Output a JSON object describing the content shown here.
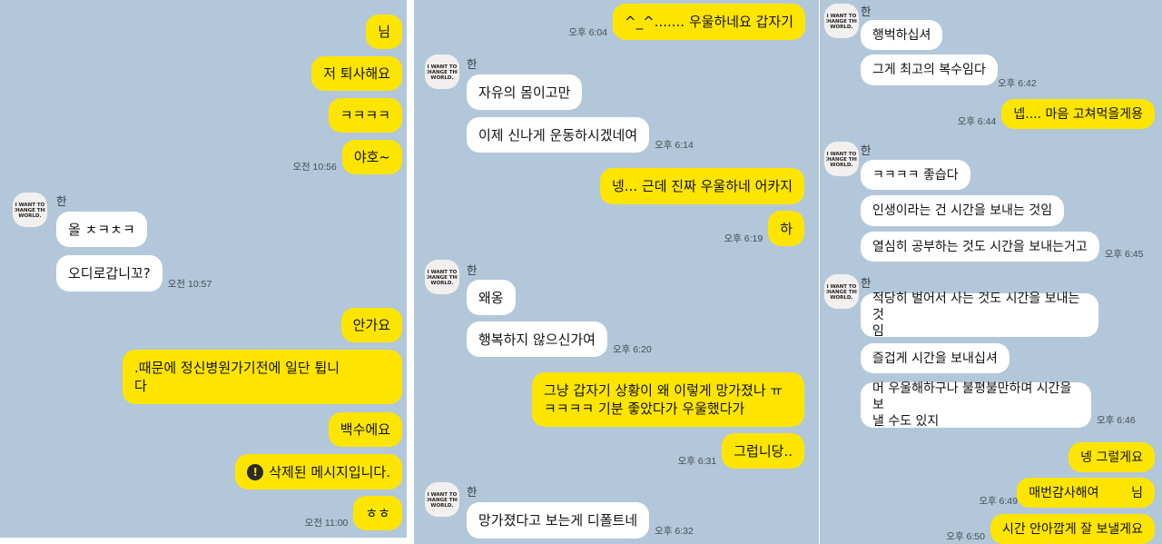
{
  "panel1": {
    "msg1": "님",
    "msg2": "저 퇴사해요",
    "msg3": "ㅋㅋㅋㅋ",
    "msg4": "야호~",
    "time1": "오전 10:56",
    "sender1": "한",
    "msg5": "올 ㅊㅋㅊㅋ",
    "msg6": "오디로갑니꼬?",
    "time2": "오전 10:57",
    "msg7": "안가요",
    "msg8": ".때문에 정신병원가기전에 일단 튑니\n다",
    "msg9": "백수에요",
    "msg10": "삭제된 메시지입니다.",
    "msg11": "ㅎㅎ",
    "time3": "오전 11:00"
  },
  "panel2": {
    "msg1": "^_^....... 우울하네요 갑자기",
    "time1": "오후 6:04",
    "sender1": "한",
    "msg2": "자유의 몸이고만",
    "msg3": "이제 신나게 운동하시겠네여",
    "time2": "오후 6:14",
    "msg4": "넹... 근데 진짜 우울하네 어카지",
    "msg5": "하",
    "time3": "오후 6:19",
    "sender2": "한",
    "msg6": "왜옹",
    "msg7": "행복하지 않으신가여",
    "time4": "오후 6:20",
    "msg8": "그냥 갑자기 상황이 왜 이렇게 망가졌나 ㅠ\nㅋㅋㅋㅋ 기분 좋았다가 우울했다가",
    "msg9": "그럽니당..",
    "time5": "오후 6:31",
    "sender3": "한",
    "msg10": "망가졌다고 보는게 디폴트네",
    "time6": "오후 6:32"
  },
  "panel3": {
    "sender1": "한",
    "msg1": "행벅하십셔",
    "msg2": "그게 최고의 복수임다",
    "time1": "오후 6:42",
    "msg3": "넵.... 마음 고쳐먹을게용",
    "time2": "오후 6:44",
    "sender2": "한",
    "msg4": "ㅋㅋㅋㅋ 좋습다",
    "msg5": "인생이라는 건 시간을 보내는 것임",
    "msg6": "열심히 공부하는 것도 시간을 보내는거고",
    "time3": "오후 6:45",
    "sender3": "한",
    "msg7": "적당히 벌어서 사는 것도 시간을 보내는 것\n임",
    "msg8": "즐겁게 시간을 보내십셔",
    "msg9": "머 우울해하구나 불평불만하며 시간을 보\n낼 수도 있지",
    "time4": "오후 6:46",
    "msg10": "넹 그럴게요",
    "msg11": "매번감사해여        님",
    "time5": "오후 6:49",
    "msg12": "시간 안아깝게 잘 보낼게요",
    "time6": "오후 6:50"
  },
  "avatar_text": "I WANT TO CHANGE THE WORLD.",
  "colors": {
    "background": "#b2c7d9",
    "my_bubble": "#fee500",
    "other_bubble": "#ffffff"
  }
}
